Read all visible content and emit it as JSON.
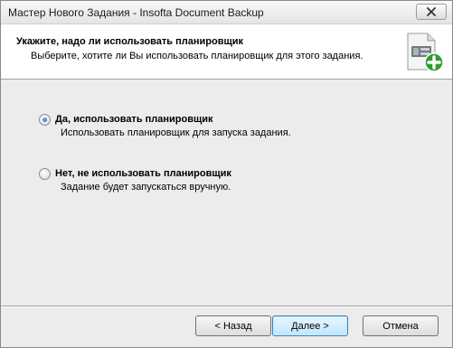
{
  "window": {
    "title": "Мастер Нового Задания - Insofta Document Backup"
  },
  "header": {
    "title": "Укажите, надо ли использовать планировщик",
    "subtitle": "Выберите, хотите ли Вы использовать планировщик для этого задания."
  },
  "options": [
    {
      "label": "Да, использовать планировщик",
      "description": "Использовать планировщик для запуска задания.",
      "checked": true
    },
    {
      "label": "Нет, не использовать планировщик",
      "description": "Задание будет запускаться вручную.",
      "checked": false
    }
  ],
  "buttons": {
    "back": "< Назад",
    "next": "Далее >",
    "cancel": "Отмена"
  },
  "icons": {
    "close": "close-icon",
    "header": "task-add-icon"
  },
  "colors": {
    "accent_plus": "#2f9e2f",
    "radio_selected": "#1d5fb8"
  }
}
